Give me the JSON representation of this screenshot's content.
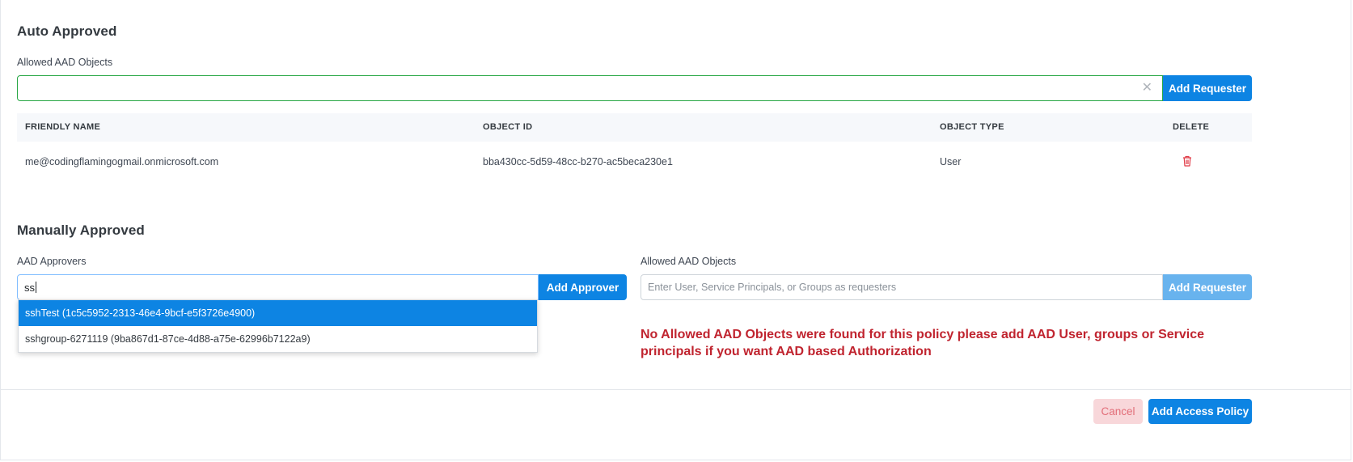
{
  "auto_approved": {
    "title": "Auto Approved",
    "allowed_label": "Allowed AAD Objects",
    "input_value": "",
    "add_button": "Add Requester",
    "table": {
      "headers": [
        "FRIENDLY NAME",
        "OBJECT ID",
        "OBJECT TYPE",
        "DELETE"
      ],
      "rows": [
        {
          "friendly_name": "me@codingflamingogmail.onmicrosoft.com",
          "object_id": "bba430cc-5d59-48cc-b270-ac5beca230e1",
          "object_type": "User"
        }
      ]
    }
  },
  "manually_approved": {
    "title": "Manually Approved",
    "approvers_label": "AAD Approvers",
    "approvers_value": "ss",
    "add_approver_button": "Add Approver",
    "suggestions": [
      "sshTest (1c5c5952-2313-46e4-9bcf-e5f3726e4900)",
      "sshgroup-6271119 (9ba867d1-87ce-4d88-a75e-62996b7122a9)"
    ],
    "allowed_label": "Allowed AAD Objects",
    "allowed_placeholder": "Enter User, Service Principals, or Groups as requesters",
    "add_requester_button": "Add Requester",
    "error_message": "No Allowed AAD Objects were found for this policy please add AAD User, groups or Service principals if you want AAD based Authorization"
  },
  "footer": {
    "cancel": "Cancel",
    "submit": "Add Access Policy"
  },
  "colors": {
    "primary": "#0d84e3",
    "danger": "#c0242f",
    "delete_icon": "#e03a46"
  }
}
